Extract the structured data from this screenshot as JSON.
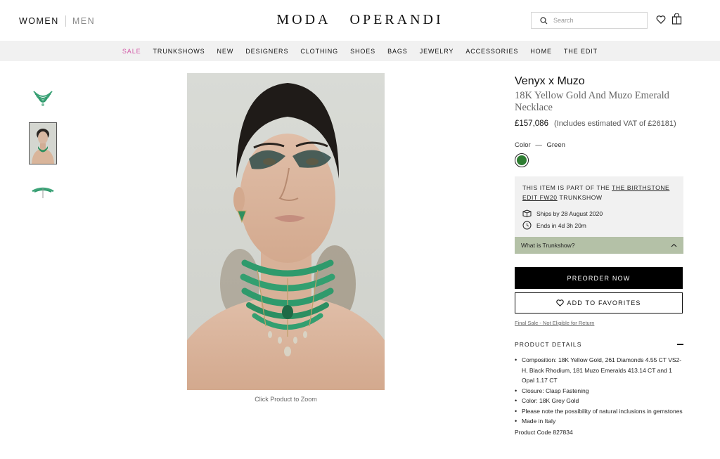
{
  "header": {
    "gender_women": "WOMEN",
    "gender_men": "MEN",
    "logo_left": "MODA",
    "logo_right": "OPERANDI",
    "search_placeholder": "Search",
    "icons": [
      "search-icon",
      "heart-icon",
      "bag-icon"
    ]
  },
  "nav": {
    "items": [
      "SALE",
      "TRUNKSHOWS",
      "NEW",
      "DESIGNERS",
      "CLOTHING",
      "SHOES",
      "BAGS",
      "JEWELRY",
      "ACCESSORIES",
      "HOME",
      "THE EDIT"
    ],
    "sale_color": "#d259a7"
  },
  "gallery": {
    "thumbnails": [
      "necklace",
      "model",
      "necklace-detail"
    ],
    "active_thumbnail": 1,
    "zoom_caption": "Click Product to Zoom"
  },
  "product": {
    "brand": "Venyx x Muzo",
    "name": "18K Yellow Gold And Muzo Emerald Necklace",
    "price": "£157,086",
    "vat_note": "(Includes estimated VAT of £26181)",
    "color_label": "Color",
    "color_dash": "—",
    "color_value": "Green",
    "swatch_color": "#2e7d32"
  },
  "trunkshow": {
    "intro": "THIS ITEM IS PART OF THE ",
    "link": "THE BIRTHSTONE EDIT FW20",
    "suffix": " TRUNKSHOW",
    "ships": "Ships by 28 August 2020",
    "ends": "Ends in 4d 3h 20m",
    "what_label": "What is Trunkshow?",
    "bar_color": "#b4c1a7"
  },
  "actions": {
    "preorder": "PREORDER NOW",
    "favorites": "ADD TO FAVORITES",
    "final_sale": "Final Sale - Not Eligible for Return"
  },
  "details": {
    "heading": "PRODUCT DETAILS",
    "items": [
      "Composition: 18K Yellow Gold, 261 Diamonds 4.55 CT VS2-H, Black Rhodium, 181 Muzo Emeralds 413.14 CT and 1 Opal 1.17 CT",
      "Closure: Clasp Fastening",
      "Color: 18K Grey Gold",
      "Please note the possibility of natural inclusions in gemstones",
      "Made in Italy"
    ],
    "product_code": "Product Code 827834"
  }
}
